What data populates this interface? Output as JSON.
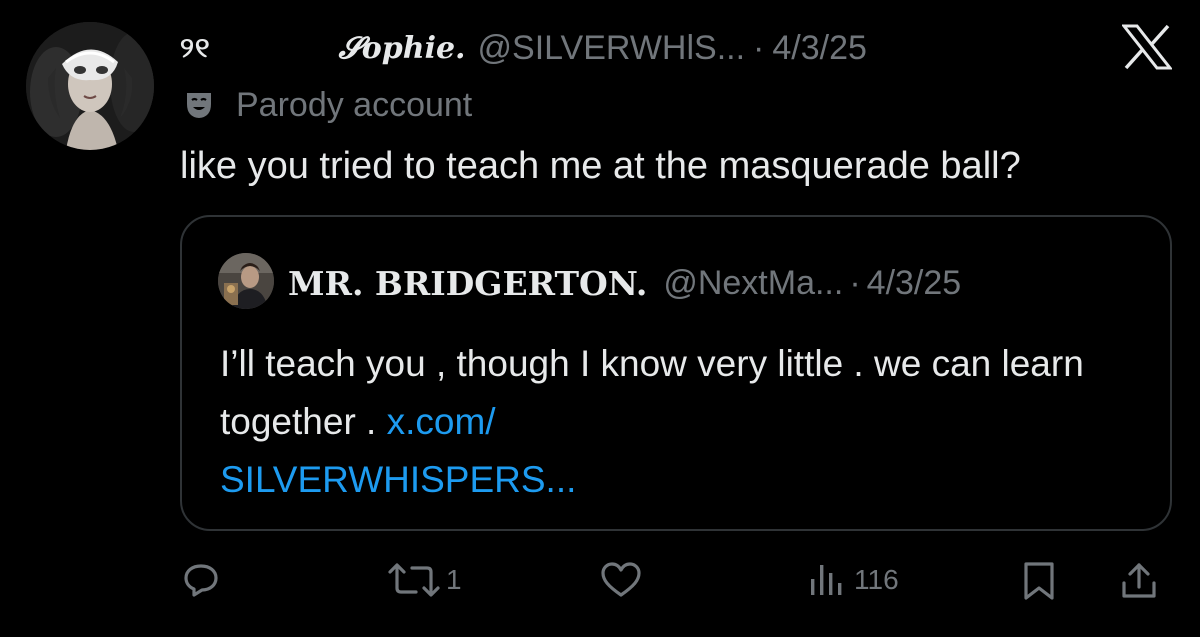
{
  "post": {
    "name_prefix": "୨୧",
    "name": "𝓢ophie.",
    "handle": "@SILVERWHlS...",
    "separator": "·",
    "date": "4/3/25",
    "label": "Parody account",
    "text": "like you tried to teach me at the masquerade ball?"
  },
  "quote": {
    "name": "MR. BRIDGERTON.",
    "handle": "@NextMa...",
    "separator": "·",
    "date": "4/3/25",
    "text": "I’ll teach you , though I know very little . we can learn together .",
    "link_line1": "x.com/",
    "link_line2": "SILVERWHISPERS..."
  },
  "actions": {
    "reply_count": "",
    "repost_count": "1",
    "like_count": "",
    "views_count": "116"
  },
  "icons": {
    "brand": "x-logo-icon",
    "parody": "mask-icon",
    "reply": "reply-icon",
    "repost": "repost-icon",
    "like": "heart-icon",
    "views": "views-icon",
    "bookmark": "bookmark-icon",
    "share": "share-icon"
  },
  "colors": {
    "background": "#000000",
    "text": "#e7e9ea",
    "muted": "#71767b",
    "link": "#1d9bf0",
    "border": "#2f3336"
  }
}
